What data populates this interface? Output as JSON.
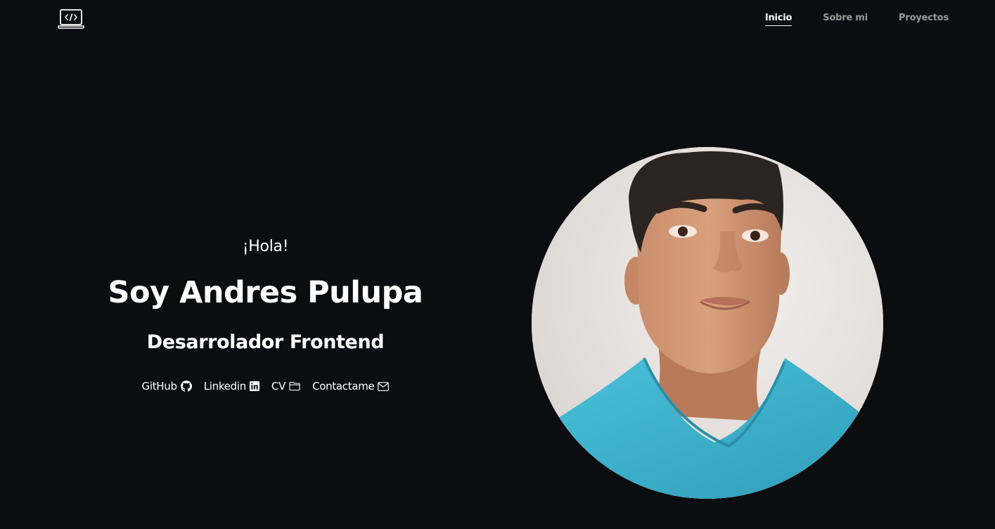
{
  "header": {
    "logo_icon": "code-laptop-icon",
    "nav": [
      {
        "label": "Inicio",
        "active": true
      },
      {
        "label": "Sobre mi",
        "active": false
      },
      {
        "label": "Proyectos",
        "active": false
      }
    ]
  },
  "hero": {
    "greeting": "¡Hola!",
    "name": "Soy Andres Pulupa",
    "role": "Desarrolador Frontend",
    "links": [
      {
        "label": "GitHub",
        "icon": "github-icon"
      },
      {
        "label": "Linkedin",
        "icon": "linkedin-icon"
      },
      {
        "label": "CV",
        "icon": "folder-icon"
      },
      {
        "label": "Contactame",
        "icon": "mail-icon"
      }
    ]
  },
  "portrait": {
    "icon": "profile-photo",
    "shirt_color": "#3fb5cf",
    "background_color": "#ebe7e4"
  },
  "colors": {
    "background": "#0c0d10",
    "text": "#ffffff",
    "nav_inactive": "#9a9a9a"
  }
}
